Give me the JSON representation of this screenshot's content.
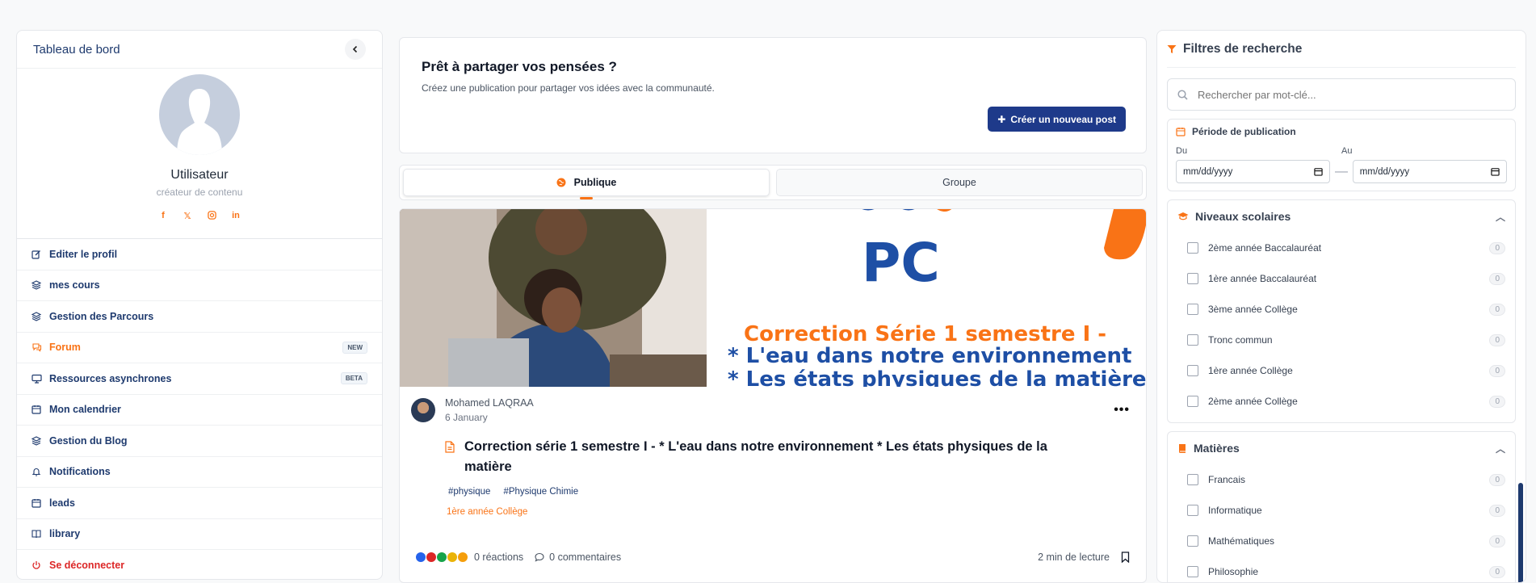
{
  "sidebar": {
    "title": "Tableau de bord",
    "profile": {
      "name": "Utilisateur",
      "role": "créateur de contenu"
    },
    "socials": [
      "facebook",
      "x",
      "instagram",
      "linkedin"
    ],
    "items": [
      {
        "label": "Editer le profil",
        "icon": "edit-icon"
      },
      {
        "label": "mes cours",
        "icon": "layers-icon"
      },
      {
        "label": "Gestion des Parcours",
        "icon": "layers-icon"
      },
      {
        "label": "Forum",
        "icon": "chat-icon",
        "badge": "NEW",
        "active": true
      },
      {
        "label": "Ressources asynchrones",
        "icon": "monitor-icon",
        "badge": "BETA"
      },
      {
        "label": "Mon calendrier",
        "icon": "calendar-icon"
      },
      {
        "label": "Gestion du Blog",
        "icon": "layers-icon"
      },
      {
        "label": "Notifications",
        "icon": "bell-icon"
      },
      {
        "label": "leads",
        "icon": "calendar-icon"
      },
      {
        "label": "library",
        "icon": "book-icon"
      },
      {
        "label": "Se déconnecter",
        "icon": "power-icon"
      }
    ]
  },
  "composer": {
    "title": "Prêt à partager vos pensées ?",
    "subtitle": "Créez une publication pour partager vos idées avec la communauté.",
    "button": "Créer un nouveau post"
  },
  "feed_tabs": [
    {
      "label": "Publique",
      "active": true
    },
    {
      "label": "Groupe",
      "active": false
    }
  ],
  "post": {
    "banner": {
      "logo_text": "PC",
      "line1": "Correction Série 1 semestre I -",
      "line2": "* L'eau dans notre environnement",
      "line3": "* Les états physiques de la matière"
    },
    "author": "Mohamed LAQRAA",
    "date": "6 January",
    "title": "Correction série 1 semestre I - * L'eau dans notre environnement * Les états physiques de la matière",
    "tags": [
      "#physique",
      "#Physique Chimie"
    ],
    "level": "1ère année Collège",
    "reactions": "0 réactions",
    "comments": "0 commentaires",
    "read_time": "2 min de lecture"
  },
  "filters": {
    "title": "Filtres de recherche",
    "search_placeholder": "Rechercher par mot-clé...",
    "period": {
      "title": "Période de publication",
      "from_label": "Du",
      "to_label": "Au",
      "from_value": "mm/dd/yyyy",
      "to_value": "mm/dd/yyyy"
    },
    "levels": {
      "title": "Niveaux scolaires",
      "items": [
        {
          "label": "2ème année Baccalauréat",
          "count": "0"
        },
        {
          "label": "1ère année Baccalauréat",
          "count": "0"
        },
        {
          "label": "3ème année Collège",
          "count": "0"
        },
        {
          "label": "Tronc commun",
          "count": "0"
        },
        {
          "label": "1ère année Collège",
          "count": "0"
        },
        {
          "label": "2ème année Collège",
          "count": "0"
        }
      ]
    },
    "subjects": {
      "title": "Matières",
      "items": [
        {
          "label": "Francais",
          "count": "0"
        },
        {
          "label": "Informatique",
          "count": "0"
        },
        {
          "label": "Mathématiques",
          "count": "0"
        },
        {
          "label": "Philosophie",
          "count": "0"
        }
      ]
    }
  },
  "colors": {
    "primary": "#1e3a8a",
    "accent": "#f97316",
    "danger": "#dc2626"
  }
}
